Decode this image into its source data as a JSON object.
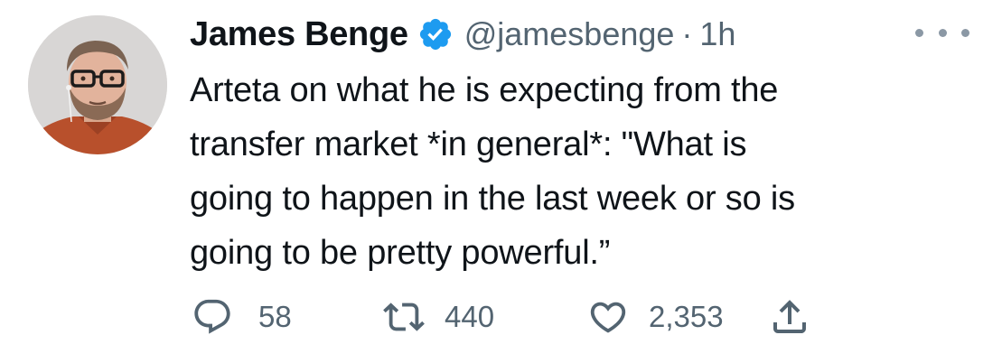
{
  "tweet": {
    "author": {
      "name": "James Benge",
      "handle": "@jamesbenge",
      "verified": true
    },
    "separator": "·",
    "time": "1h",
    "text": "Arteta on what he is expecting from the\ntransfer market *in general*: \"What is\ngoing to happen in the last week or so is\ngoing to be pretty powerful.”",
    "stats": {
      "replies": "58",
      "retweets": "440",
      "likes": "2,353"
    },
    "icons": {
      "verified": "verified-badge-icon",
      "more": "more-options-icon",
      "reply": "reply-icon",
      "retweet": "retweet-icon",
      "like": "heart-icon",
      "share": "share-icon"
    },
    "colors": {
      "verified": "#1d9bf0",
      "text": "#0f1419",
      "secondary": "#536471"
    }
  }
}
